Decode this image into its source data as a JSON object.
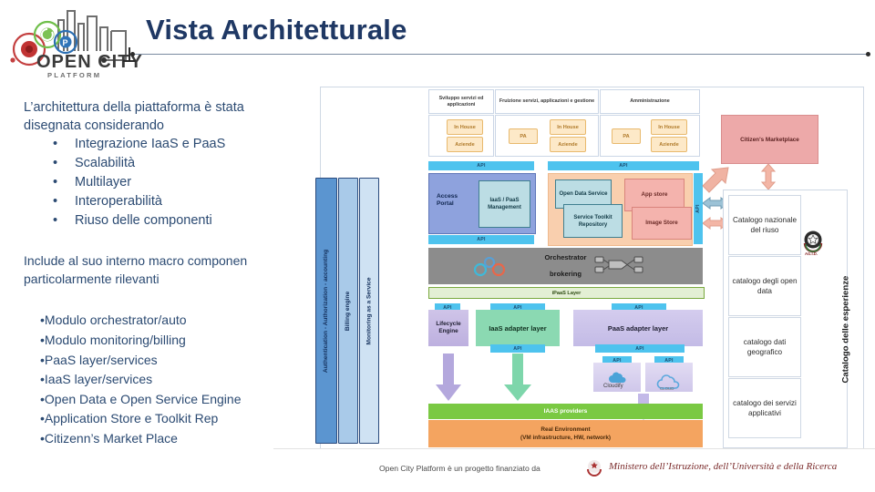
{
  "slide": {
    "title": "Vista Architetturale",
    "logo_alt": "Open City Platform",
    "logo_word1": "OPEN CITY",
    "logo_word2": "P L A T F O R M"
  },
  "left": {
    "lead": "L’architettura della piattaforma è stata disegnata considerando",
    "bullets": [
      "Integrazione IaaS e PaaS",
      "Scalabilità",
      "Multilayer",
      "Interoperabilità",
      "Riuso delle componenti"
    ],
    "lead2": "Include al suo interno macro componen particolarmente rilevanti",
    "bullets2": [
      "Modulo orchestrator/auto",
      "Modulo monitoring/billing",
      "PaaS layer/services",
      "IaaS layer/services",
      "Open Data e Open Service Engine",
      "Application Store e Toolkit Rep",
      "Citizenn’s Market Place"
    ],
    "bullet_glyph": "•"
  },
  "diagram": {
    "side_bars": [
      "Authentication - Authorization - accounting",
      "Billing engine",
      "Monitoring as a Service"
    ],
    "actor_columns": [
      {
        "header": "Sviluppo servizi ed applicazioni",
        "pills": [
          "In House",
          "Aziende"
        ]
      },
      {
        "header": "Fruizione servizi, applicazioni e gestione",
        "pills": [
          "PA",
          "In House",
          "Aziende"
        ]
      },
      {
        "header": "Amministrazione",
        "pills": [
          "PA",
          "In House",
          "Aziende"
        ]
      }
    ],
    "api_label": "API",
    "access_portal": "Access Portal",
    "iaas_paas_management": "IaaS / PaaS Management",
    "open_data_service": "Open Data Service",
    "service_toolkit_repository": "Service Toolkit Repository",
    "app_store": "App store",
    "image_store": "Image Store",
    "orchestrator": "Orchestrator",
    "brokering": "brokering",
    "ipaas_layer": "iPaaS Layer",
    "lifecycle_engine": "Lifecycle Engine",
    "iaas_adapter_layer": "IaaS adapter layer",
    "paas_adapter_layer": "PaaS adapter layer",
    "provider_cloudify": "Cloudify",
    "provider_cloud": "CLOUD",
    "iaas_providers": "IAAS providers",
    "real_environment_l1": "Real Environment",
    "real_environment_l2": "(VM infrastructure, HW, network)",
    "citizens_marketplace": "Citizen's Marketplace",
    "catalogs": [
      "Catalogo nazionale del riuso",
      "catalogo degli open data",
      "catalogo dati geografico",
      "catalogo dei servizi applicativi"
    ],
    "catalog_side_label": "Catalogo delle esperienze",
    "agid_label": "AG.I.D."
  },
  "footer": {
    "text": "Open City Platform è un progetto finanziato da",
    "ministry": "Ministero dell’Istruzione, dell’Università e della Ricerca"
  },
  "colors": {
    "title": "#1f3864",
    "body_text": "#2b4a72",
    "api": "#4ec3ee",
    "access_portal": "#8ea2dd",
    "peach": "#f9cfae",
    "teal": "#bcdde4",
    "pink": "#f4b3ad",
    "orchestrator": "#8c8c8c",
    "ipaas": "#e3efd4",
    "iaas_adapter": "#8bd9b2",
    "paas_adapter": "#c3bbe6",
    "iaas_providers": "#7ac943",
    "real_environment": "#f4a460",
    "marketplace": "#eda9a9",
    "pill": "#fde9c8"
  }
}
